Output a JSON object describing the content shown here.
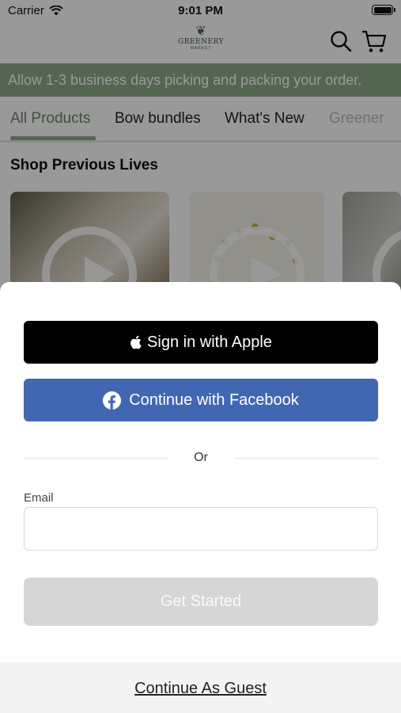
{
  "status_bar": {
    "carrier": "Carrier",
    "time": "9:01 PM"
  },
  "header": {
    "logo_text": "GREENERY",
    "logo_subtext": "MARKET"
  },
  "banner": {
    "text": "Allow 1-3 business days picking and packing your order."
  },
  "tabs": [
    {
      "label": "All Products"
    },
    {
      "label": "Bow bundles"
    },
    {
      "label": "What's New"
    },
    {
      "label": "Greener"
    }
  ],
  "section": {
    "title": "Shop Previous Lives"
  },
  "sheet": {
    "apple_label": "Sign in with Apple",
    "facebook_label": "Continue with Facebook",
    "or_label": "Or",
    "email_label": "Email",
    "email_value": "",
    "email_placeholder": "",
    "get_started_label": "Get Started",
    "guest_label": "Continue As Guest"
  },
  "colors": {
    "brand_green": "#8cab88",
    "apple_black": "#000000",
    "facebook_blue": "#4267b2",
    "disabled_gray": "#d6d6d6"
  }
}
